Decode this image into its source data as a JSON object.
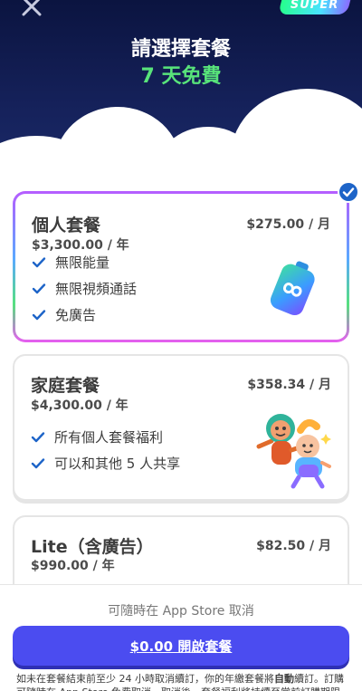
{
  "header": {
    "title": "請選擇套餐",
    "subtitle": "7 天免費",
    "super_badge": "SUPER"
  },
  "plans": [
    {
      "name": "個人套餐",
      "price": "$275.00 / 月",
      "yearly": "$3,300.00 / 年",
      "selected": true,
      "features": [
        "無限能量",
        "無限視頻通話",
        "免廣告"
      ]
    },
    {
      "name": "家庭套餐",
      "price": "$358.34 / 月",
      "yearly": "$4,300.00 / 年",
      "selected": false,
      "features": [
        "所有個人套餐福利",
        "可以和其他 5 人共享"
      ]
    },
    {
      "name": "Lite（含廣告）",
      "price": "$82.50 / 月",
      "yearly": "$990.00 / 年",
      "selected": false,
      "features": []
    }
  ],
  "footer": {
    "cancel_note": "可隨時在 App Store 取消",
    "cta_label": "$0.00 開啟套餐",
    "disclaimer_pre": "如未在套餐結束前至少 24 小時取消續訂，你的年繳套餐將",
    "disclaimer_bold": "自動",
    "disclaimer_post": "續訂。訂購可隨時在 App Store 免費取消。取消後，套餐福利將持續至當前訂購期限屆結"
  },
  "colors": {
    "hero_dark": "#0b1440",
    "subtitle_green": "#58e37a",
    "cta_purple": "#4b4cf0",
    "check_blue": "#1d64c8"
  }
}
